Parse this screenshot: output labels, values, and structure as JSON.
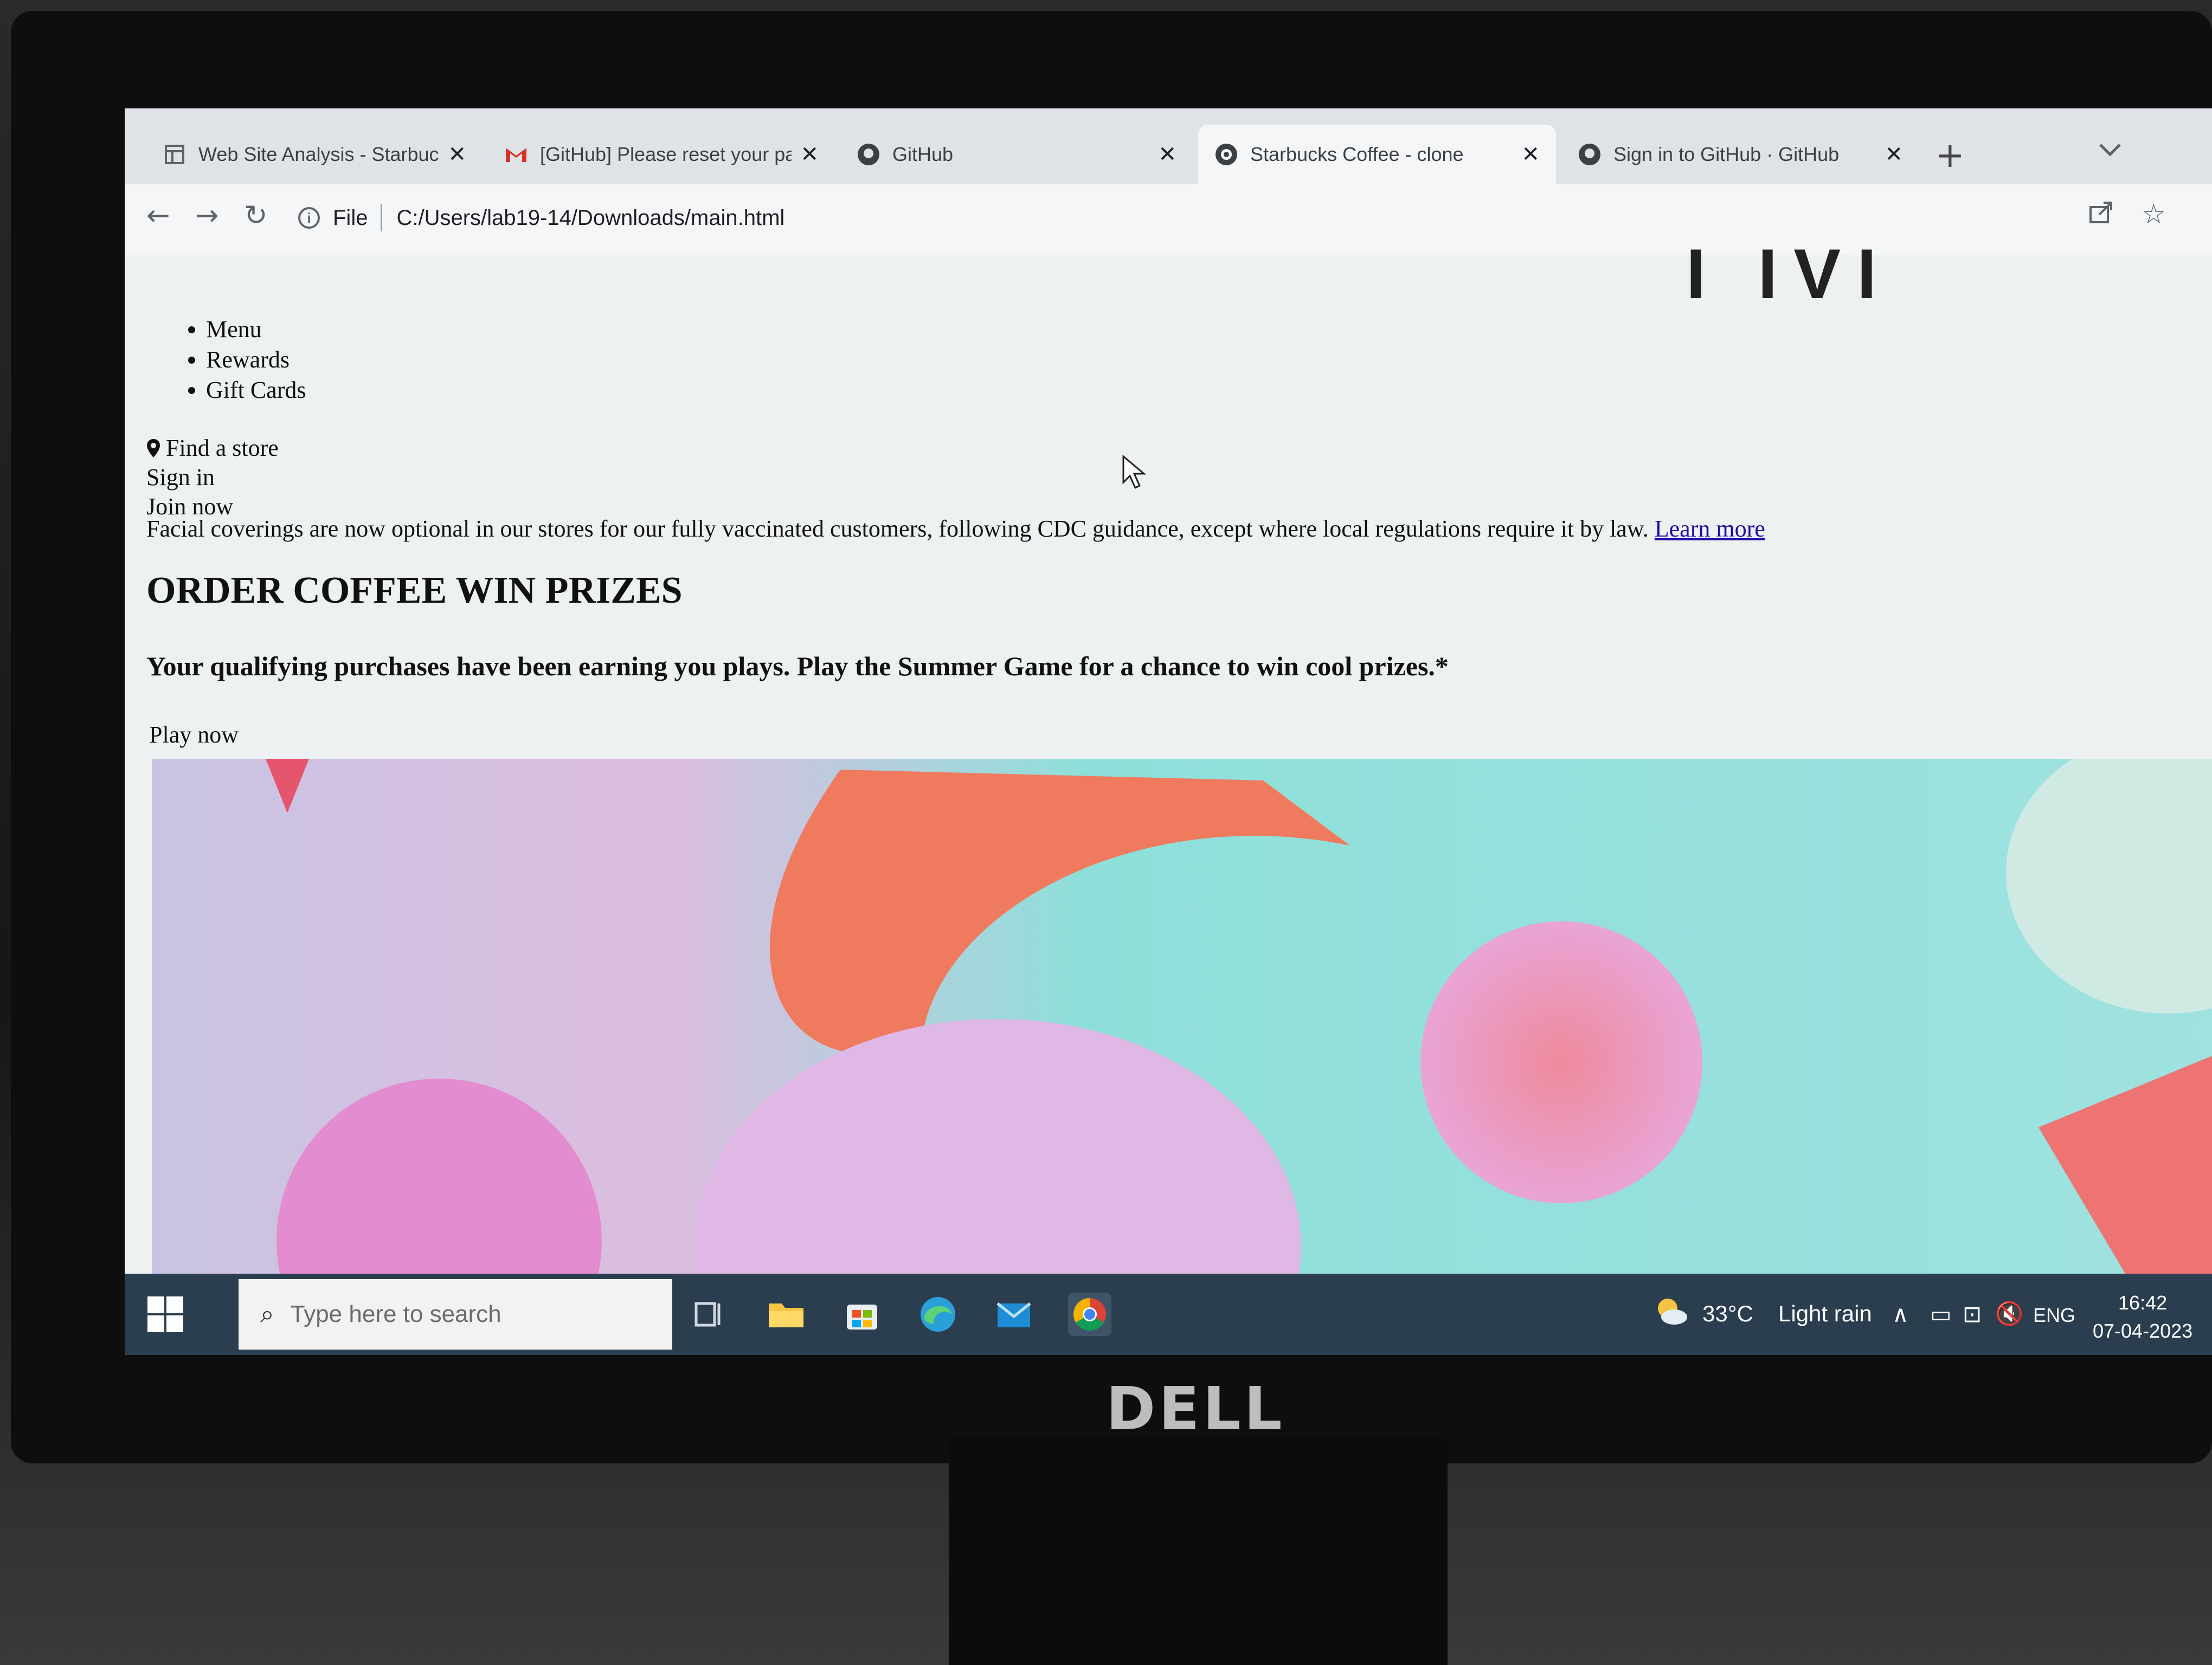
{
  "browser": {
    "tabs": [
      {
        "title": "Web Site Analysis - Starbucks",
        "icon": "doc-icon"
      },
      {
        "title": "[GitHub] Please reset your pa",
        "icon": "gmail-icon"
      },
      {
        "title": "GitHub",
        "icon": "github-icon"
      },
      {
        "title": "Starbucks Coffee - clone",
        "icon": "starbucks-icon",
        "active": true
      },
      {
        "title": "Sign in to GitHub · GitHub",
        "icon": "github-icon"
      }
    ],
    "close_glyph": "✕",
    "new_tab_glyph": "+",
    "address": {
      "scheme_label": "File",
      "url": "C:/Users/lab19-14/Downloads/main.html"
    }
  },
  "page": {
    "nav": [
      "Menu",
      "Rewards",
      "Gift Cards"
    ],
    "find_store": "Find a store",
    "sign_in": "Sign in",
    "join_now": "Join now",
    "notice_text": "Facial coverings are now optional in our stores for our fully vaccinated customers, following CDC guidance, except where local regulations require it by law.",
    "notice_link": "Learn more",
    "heading": "ORDER COFFEE WIN PRIZES",
    "lead": "Your qualifying purchases have been earning you plays. Play the Summer Game for a chance to win cool prizes.*",
    "play_now": "Play now"
  },
  "taskbar": {
    "search_placeholder": "Type here to search",
    "weather_temp": "33°C",
    "weather_text": "Light rain",
    "language": "ENG",
    "time": "16:42",
    "date": "07-04-2023"
  },
  "monitor_brand": "DELL",
  "colors": {
    "link": "#1a0dab",
    "taskbar": "#2b3e50",
    "banner_coral": "#f07a5c",
    "banner_pink": "#e88fc9",
    "banner_teal": "#8edfd9"
  }
}
